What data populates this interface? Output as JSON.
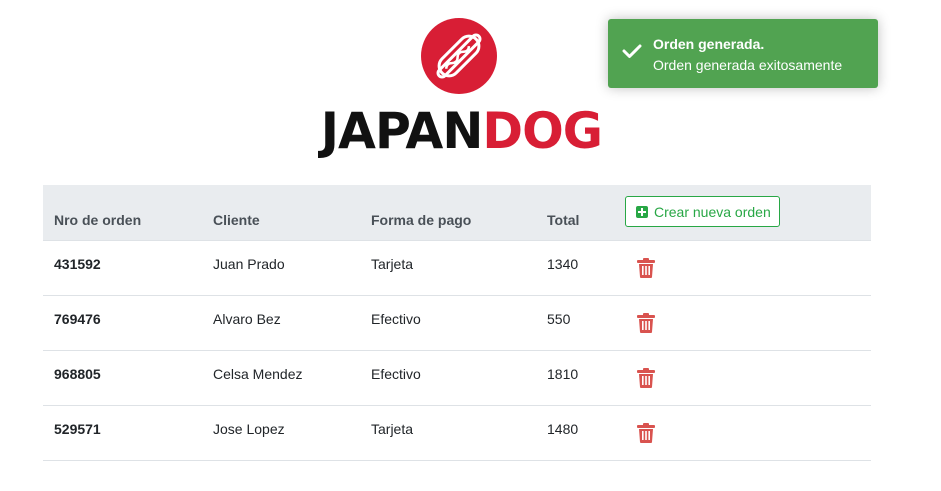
{
  "brand": {
    "logo_part1": "JAPAN",
    "logo_part2": "DOG",
    "primary_color": "#d81e35"
  },
  "table": {
    "headers": {
      "order": "Nro de orden",
      "client": "Cliente",
      "payment": "Forma de pago",
      "total": "Total"
    },
    "new_order_label": "Crear nueva orden",
    "rows": [
      {
        "order": "431592",
        "client": "Juan Prado",
        "payment": "Tarjeta",
        "total": "1340"
      },
      {
        "order": "769476",
        "client": "Alvaro Bez",
        "payment": "Efectivo",
        "total": "550"
      },
      {
        "order": "968805",
        "client": "Celsa Mendez",
        "payment": "Efectivo",
        "total": "1810"
      },
      {
        "order": "529571",
        "client": "Jose Lopez",
        "payment": "Tarjeta",
        "total": "1480"
      }
    ]
  },
  "toast": {
    "title": "Orden generada.",
    "message": "Orden generada exitosamente",
    "color": "#51a351"
  },
  "icons": {
    "logo": "hotdog-icon",
    "new_order": "plus-square-icon",
    "delete": "trash-icon",
    "toast": "check-icon"
  }
}
